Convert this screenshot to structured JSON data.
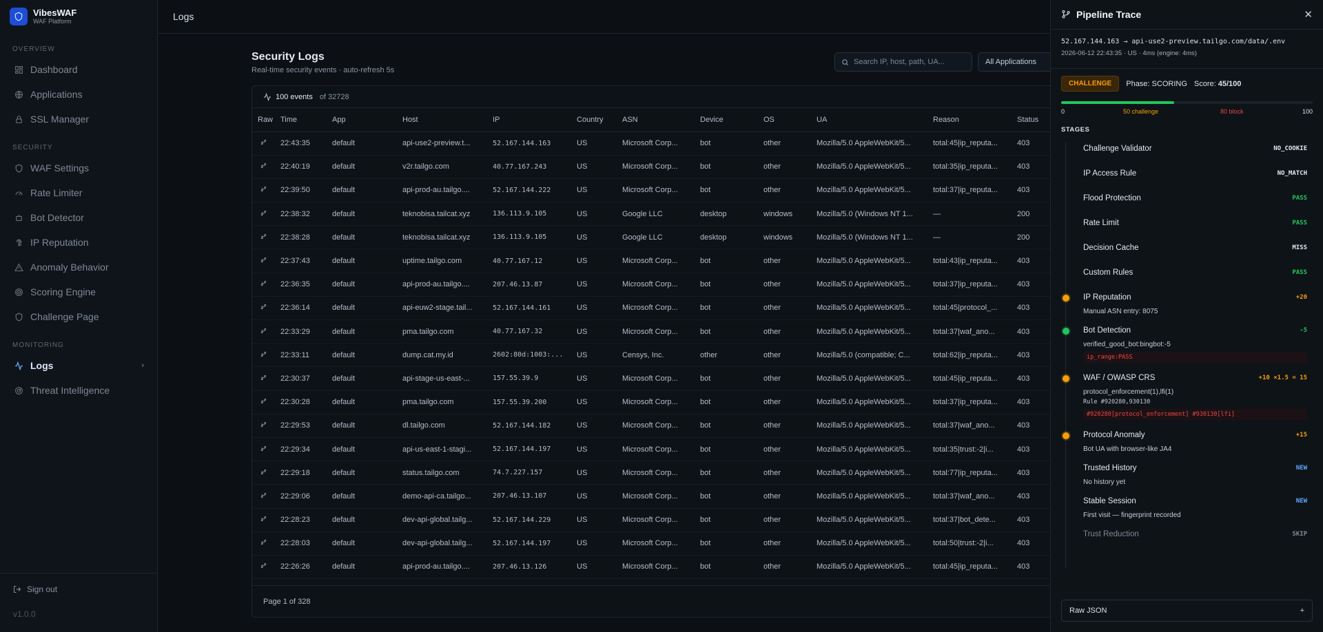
{
  "brand": {
    "name": "VibesWAF",
    "subtitle": "WAF Platform"
  },
  "sidebar": {
    "sections": [
      {
        "title": "OVERVIEW",
        "items": [
          {
            "label": "Dashboard",
            "icon": "dashboard-icon"
          },
          {
            "label": "Applications",
            "icon": "globe-icon"
          },
          {
            "label": "SSL Manager",
            "icon": "lock-icon"
          }
        ]
      },
      {
        "title": "SECURITY",
        "items": [
          {
            "label": "WAF Settings",
            "icon": "shield-icon"
          },
          {
            "label": "Rate Limiter",
            "icon": "gauge-icon"
          },
          {
            "label": "Bot Detector",
            "icon": "bot-icon"
          },
          {
            "label": "IP Reputation",
            "icon": "fingerprint-icon"
          },
          {
            "label": "Anomaly Behavior",
            "icon": "warning-icon"
          },
          {
            "label": "Scoring Engine",
            "icon": "target-icon"
          },
          {
            "label": "Challenge Page",
            "icon": "shield-icon"
          }
        ]
      },
      {
        "title": "MONITORING",
        "items": [
          {
            "label": "Logs",
            "icon": "activity-icon",
            "active": true
          },
          {
            "label": "Threat Intelligence",
            "icon": "radar-icon"
          }
        ]
      }
    ],
    "signout": "Sign out",
    "version": "v1.0.0"
  },
  "topbar": {
    "title": "Logs"
  },
  "main": {
    "title": "Security Logs",
    "subtitle": "Real-time security events · auto-refresh 5s",
    "search_placeholder": "Search IP, host, path, UA...",
    "app_filter": "All Applications",
    "events_count": "100 events",
    "events_total": "of 32728",
    "pagination": "Page 1 of 328"
  },
  "table": {
    "columns": [
      "Raw",
      "Time",
      "App",
      "Host",
      "IP",
      "Country",
      "ASN",
      "Device",
      "OS",
      "UA",
      "Reason",
      "Status"
    ],
    "rows": [
      [
        "22:43:35",
        "default",
        "api-use2-preview.t...",
        "52.167.144.163",
        "US",
        "Microsoft Corp...",
        "bot",
        "other",
        "Mozilla/5.0 AppleWebKit/5...",
        "total:45|ip_reputa...",
        "403"
      ],
      [
        "22:40:19",
        "default",
        "v2r.tailgo.com",
        "40.77.167.243",
        "US",
        "Microsoft Corp...",
        "bot",
        "other",
        "Mozilla/5.0 AppleWebKit/5...",
        "total:35|ip_reputa...",
        "403"
      ],
      [
        "22:39:50",
        "default",
        "api-prod-au.tailgo....",
        "52.167.144.222",
        "US",
        "Microsoft Corp...",
        "bot",
        "other",
        "Mozilla/5.0 AppleWebKit/5...",
        "total:37|ip_reputa...",
        "403"
      ],
      [
        "22:38:32",
        "default",
        "teknobisa.tailcat.xyz",
        "136.113.9.105",
        "US",
        "Google LLC",
        "desktop",
        "windows",
        "Mozilla/5.0 (Windows NT 1...",
        "—",
        "200"
      ],
      [
        "22:38:28",
        "default",
        "teknobisa.tailcat.xyz",
        "136.113.9.105",
        "US",
        "Google LLC",
        "desktop",
        "windows",
        "Mozilla/5.0 (Windows NT 1...",
        "—",
        "200"
      ],
      [
        "22:37:43",
        "default",
        "uptime.tailgo.com",
        "40.77.167.12",
        "US",
        "Microsoft Corp...",
        "bot",
        "other",
        "Mozilla/5.0 AppleWebKit/5...",
        "total:43|ip_reputa...",
        "403"
      ],
      [
        "22:36:35",
        "default",
        "api-prod-au.tailgo....",
        "207.46.13.87",
        "US",
        "Microsoft Corp...",
        "bot",
        "other",
        "Mozilla/5.0 AppleWebKit/5...",
        "total:37|ip_reputa...",
        "403"
      ],
      [
        "22:36:14",
        "default",
        "api-euw2-stage.tail...",
        "52.167.144.161",
        "US",
        "Microsoft Corp...",
        "bot",
        "other",
        "Mozilla/5.0 AppleWebKit/5...",
        "total:45|protocol_...",
        "403"
      ],
      [
        "22:33:29",
        "default",
        "pma.tailgo.com",
        "40.77.167.32",
        "US",
        "Microsoft Corp...",
        "bot",
        "other",
        "Mozilla/5.0 AppleWebKit/5...",
        "total:37|waf_ano...",
        "403"
      ],
      [
        "22:33:11",
        "default",
        "dump.cat.my.id",
        "2602:80d:1003:...",
        "US",
        "Censys, Inc.",
        "other",
        "other",
        "Mozilla/5.0 (compatible; C...",
        "total:62|ip_reputa...",
        "403"
      ],
      [
        "22:30:37",
        "default",
        "api-stage-us-east-...",
        "157.55.39.9",
        "US",
        "Microsoft Corp...",
        "bot",
        "other",
        "Mozilla/5.0 AppleWebKit/5...",
        "total:45|ip_reputa...",
        "403"
      ],
      [
        "22:30:28",
        "default",
        "pma.tailgo.com",
        "157.55.39.200",
        "US",
        "Microsoft Corp...",
        "bot",
        "other",
        "Mozilla/5.0 AppleWebKit/5...",
        "total:37|ip_reputa...",
        "403"
      ],
      [
        "22:29:53",
        "default",
        "dl.tailgo.com",
        "52.167.144.182",
        "US",
        "Microsoft Corp...",
        "bot",
        "other",
        "Mozilla/5.0 AppleWebKit/5...",
        "total:37|waf_ano...",
        "403"
      ],
      [
        "22:29:34",
        "default",
        "api-us-east-1-stagi...",
        "52.167.144.197",
        "US",
        "Microsoft Corp...",
        "bot",
        "other",
        "Mozilla/5.0 AppleWebKit/5...",
        "total:35|trust:-2|i...",
        "403"
      ],
      [
        "22:29:18",
        "default",
        "status.tailgo.com",
        "74.7.227.157",
        "US",
        "Microsoft Corp...",
        "bot",
        "other",
        "Mozilla/5.0 AppleWebKit/5...",
        "total:77|ip_reputa...",
        "403"
      ],
      [
        "22:29:06",
        "default",
        "demo-api-ca.tailgo...",
        "207.46.13.107",
        "US",
        "Microsoft Corp...",
        "bot",
        "other",
        "Mozilla/5.0 AppleWebKit/5...",
        "total:37|waf_ano...",
        "403"
      ],
      [
        "22:28:23",
        "default",
        "dev-api-global.tailg...",
        "52.167.144.229",
        "US",
        "Microsoft Corp...",
        "bot",
        "other",
        "Mozilla/5.0 AppleWebKit/5...",
        "total:37|bot_dete...",
        "403"
      ],
      [
        "22:28:03",
        "default",
        "dev-api-global.tailg...",
        "52.167.144.197",
        "US",
        "Microsoft Corp...",
        "bot",
        "other",
        "Mozilla/5.0 AppleWebKit/5...",
        "total:50|trust:-2|i...",
        "403"
      ],
      [
        "22:26:26",
        "default",
        "api-prod-au.tailgo....",
        "207.46.13.126",
        "US",
        "Microsoft Corp...",
        "bot",
        "other",
        "Mozilla/5.0 AppleWebKit/5...",
        "total:45|ip_reputa...",
        "403"
      ]
    ]
  },
  "trace": {
    "title": "Pipeline Trace",
    "ip": "52.167.144.163",
    "arrow": "→",
    "url": "api-use2-preview.tailgo.com/data/.env",
    "timestamp": "2026-06-12 22:43:35",
    "country": "· US",
    "timing": "· 4ms (engine: 4ms)",
    "verdict": "CHALLENGE",
    "phase": "Phase: SCORING",
    "score_label": "Score:",
    "score": "45/100",
    "score_fraction": 0.45,
    "scale": {
      "min": "0",
      "challenge": "50 challenge",
      "block": "80 block",
      "max": "100"
    },
    "stages_title": "STAGES",
    "stages": [
      {
        "name": "Challenge Validator",
        "result": "NO_COOKIE",
        "color": "#e5e9f0"
      },
      {
        "name": "IP Access Rule",
        "result": "NO_MATCH",
        "color": "#e5e9f0"
      },
      {
        "name": "Flood Protection",
        "result": "PASS",
        "color": "#22c55e"
      },
      {
        "name": "Rate Limit",
        "result": "PASS",
        "color": "#22c55e"
      },
      {
        "name": "Decision Cache",
        "result": "MISS",
        "color": "#e5e9f0"
      },
      {
        "name": "Custom Rules",
        "result": "PASS",
        "color": "#22c55e"
      },
      {
        "name": "IP Reputation",
        "result": "+20",
        "color": "#f59e0b",
        "dot": "#f59e0b",
        "detail": "Manual ASN entry: 8075"
      },
      {
        "name": "Bot Detection",
        "result": "-5",
        "color": "#22c55e",
        "dot": "#22c55e",
        "detail": "verified_good_bot:bingbot:-5",
        "chip": "ip_range:PASS"
      },
      {
        "name": "WAF / OWASP CRS",
        "result": "+10 ×1.5 = 15",
        "color": "#f59e0b",
        "dot": "#f59e0b",
        "detail": "protocol_enforcement(1),lfi(1)",
        "rule": "Rule #920280,930130",
        "chip": "#920280[protocol_enforcement] #930130[lfi]"
      },
      {
        "name": "Protocol Anomaly",
        "result": "+15",
        "color": "#f59e0b",
        "dot": "#f59e0b",
        "detail": "Bot UA with browser-like JA4"
      },
      {
        "name": "Trusted History",
        "result": "NEW",
        "color": "#60a5fa",
        "detail": "No history yet"
      },
      {
        "name": "Stable Session",
        "result": "NEW",
        "color": "#60a5fa",
        "detail": "First visit — fingerprint recorded"
      },
      {
        "name": "Trust Reduction",
        "result": "SKIP",
        "color": "#7e8897",
        "dim": true
      }
    ],
    "raw_json_label": "Raw JSON",
    "raw_json_toggle": "+"
  },
  "colors": {
    "accent": "#60a5fa",
    "warning": "#f59e0b",
    "success": "#22c55e",
    "danger": "#ef4444"
  }
}
